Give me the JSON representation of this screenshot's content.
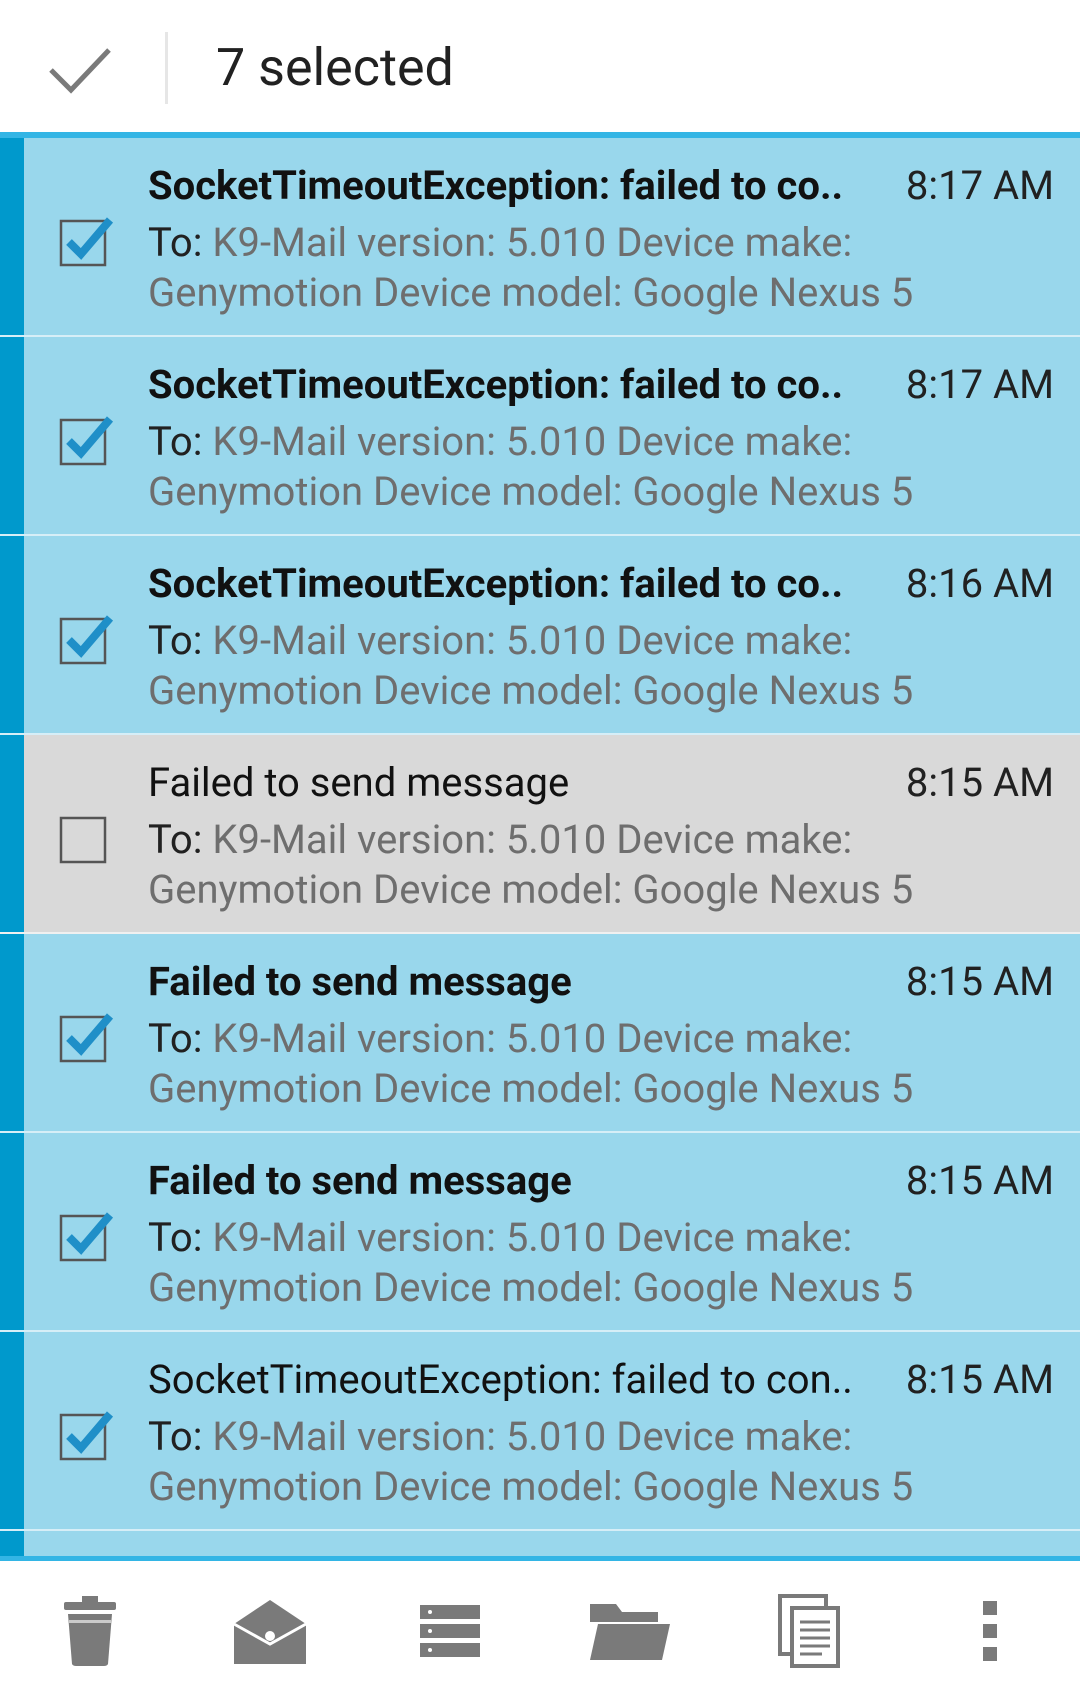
{
  "action_bar": {
    "selected_label": "7 selected",
    "done_icon": "check-icon"
  },
  "colors": {
    "selected_bg": "#99d7ec",
    "unselected_bg": "#d9d9d9",
    "accent": "#0099cc",
    "rule": "#33b5e5",
    "preview_text": "#6e6e6e",
    "icon_gray": "#7a7a7a"
  },
  "messages": [
    {
      "subject": "SocketTimeoutException: failed to co..",
      "time": "8:17 AM",
      "to_label": "To:",
      "preview": "K9-Mail version: 5.010 Device make: Genymotion Device model: Google Nexus 5",
      "selected": true,
      "bold": true
    },
    {
      "subject": "SocketTimeoutException: failed to co..",
      "time": "8:17 AM",
      "to_label": "To:",
      "preview": "K9-Mail version: 5.010 Device make: Genymotion Device model: Google Nexus 5",
      "selected": true,
      "bold": true
    },
    {
      "subject": "SocketTimeoutException: failed to co..",
      "time": "8:16 AM",
      "to_label": "To:",
      "preview": "K9-Mail version: 5.010 Device make: Genymotion Device model: Google Nexus 5",
      "selected": true,
      "bold": true
    },
    {
      "subject": "Failed to send message",
      "time": "8:15 AM",
      "to_label": "To:",
      "preview": "K9-Mail version: 5.010 Device make: Genymotion Device model: Google Nexus 5",
      "selected": false,
      "bold": false
    },
    {
      "subject": "Failed to send message",
      "time": "8:15 AM",
      "to_label": "To:",
      "preview": "K9-Mail version: 5.010 Device make: Genymotion Device model: Google Nexus 5",
      "selected": true,
      "bold": true
    },
    {
      "subject": "Failed to send message",
      "time": "8:15 AM",
      "to_label": "To:",
      "preview": "K9-Mail version: 5.010 Device make: Genymotion Device model: Google Nexus 5",
      "selected": true,
      "bold": true
    },
    {
      "subject": "SocketTimeoutException: failed to con..",
      "time": "8:15 AM",
      "to_label": "To:",
      "preview": "K9-Mail version: 5.010 Device make: Genymotion Device model: Google Nexus 5",
      "selected": true,
      "bold": false
    }
  ],
  "bottom_actions": [
    {
      "icon": "trash-icon"
    },
    {
      "icon": "mark-read-icon"
    },
    {
      "icon": "archive-icon"
    },
    {
      "icon": "move-folder-icon"
    },
    {
      "icon": "copy-icon"
    },
    {
      "icon": "overflow-menu-icon"
    }
  ]
}
